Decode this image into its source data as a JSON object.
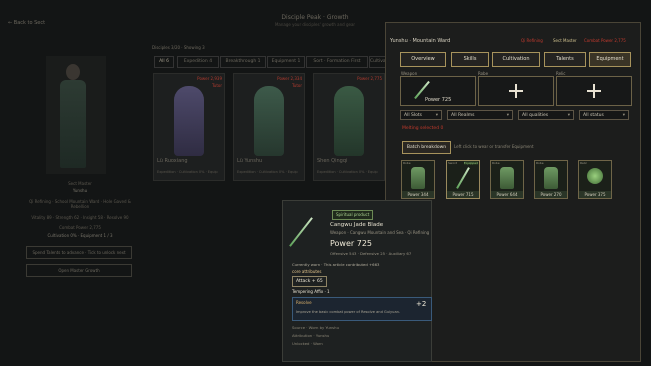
{
  "background": {
    "back_label": "Back to Sect",
    "title": "Disciple Peak · Growth",
    "subtitle": "Manage your disciples' growth and gear",
    "left_panel": {
      "rank": "Sect Master",
      "name": "Yunshu",
      "lines": [
        "Qi Refining · School Mountain Ward · Hole Gaved & Rebellion",
        "Vitality 89 · Strength 62 · Insight 58 · Resolve 90",
        "Combat Power 2,775"
      ],
      "cultivation": "Cultivation 0% · Equipment 1 / 3",
      "buttons": [
        "Spend Talents to advance · Tick to unlock next",
        "Open Master Growth"
      ]
    },
    "list_info": "Disciples 3/20 · Showing 3",
    "tabs": [
      "All 6",
      "Expedition 4",
      "Breakthrough 1",
      "Equipment 1",
      "Sort · Formation First",
      "Cultivation"
    ],
    "cards": [
      {
        "power": "Power 2,939",
        "status": "Tutor",
        "name": "Lü Ruoxiang",
        "line": "Expedition ·  Cultivation 0% · Equip"
      },
      {
        "power": "Power 2,334",
        "status": "Tutor",
        "name": "Lü Yunshu",
        "line": "Expedition ·  Cultivation 0% · Equip"
      },
      {
        "power": "Power 2,775",
        "status": "",
        "name": "Shen Qingqi",
        "line": "Expedition ·  Cultivation 0% · Equip"
      }
    ]
  },
  "panel": {
    "header_name": "Yunshu · Mountain Ward",
    "badge_realm": "Qi Refining",
    "badge_role": "Sect Master",
    "badge_power": "Combat Power 2,775",
    "tabs": [
      "Overview",
      "Skills",
      "Cultivation",
      "Talents",
      "Equipment"
    ],
    "slots": [
      {
        "label": "Weapon",
        "power": "Power 725",
        "filled": true
      },
      {
        "label": "Robe",
        "power": "",
        "filled": false
      },
      {
        "label": "Relic",
        "power": "",
        "filled": false
      }
    ],
    "filters": [
      "All Slots",
      "All Realms",
      "All qualities",
      "All status"
    ],
    "melting_selected": "Melting selected 0",
    "batch_label": "Batch breakdown",
    "batch_hint": "Left click to wear or transfer Equipment",
    "items": [
      {
        "label": "Robe",
        "power": "Power 344"
      },
      {
        "label": "Sword",
        "power": "Power 715",
        "tag": "Equipped"
      },
      {
        "label": "Robe",
        "power": "Power 644"
      },
      {
        "label": "Robe",
        "power": "Power 270"
      },
      {
        "label": "Relic",
        "power": "Power 375"
      }
    ]
  },
  "tooltip": {
    "chip": "Spiritual product",
    "name": "Cangwu Jade Blade",
    "meta": "Weapon · Cangwu Mountain and Sea · Qi Refining",
    "power": "Power 725",
    "sub": "Offensive 543 · Defensive 25 · Auxiliary 67",
    "current": "Currently worn · This article contributed +663",
    "core_label": "core attributes",
    "attack": "Attack + 65",
    "tempering": "Tempering Affix · 1",
    "affix_title": "Resolve",
    "affix_desc": "Improve the basic combat power of Resolve and Guiyuan.",
    "affix_value": "+2",
    "footer": [
      "Source · Worn by Yunshu",
      "Attribution · Yunshu",
      "Unlocked · Worn"
    ]
  },
  "colors": {
    "accent_gold": "#a7935c",
    "danger": "#c0392b",
    "jade": "#6f9a63"
  }
}
